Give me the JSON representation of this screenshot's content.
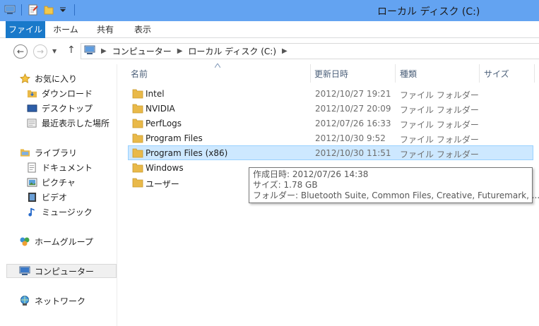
{
  "window": {
    "title": "ローカル ディスク (C:)"
  },
  "quick_access": {
    "icons": [
      "computer-icon",
      "properties-icon",
      "new-folder-icon",
      "customize-dropdown-icon"
    ]
  },
  "ribbon": {
    "tabs": [
      "ファイル",
      "ホーム",
      "共有",
      "表示"
    ],
    "active_tab": "ファイル",
    "accent": "#1979ca"
  },
  "titlebar": {
    "color": "#63a3f1"
  },
  "address": {
    "breadcrumbs": [
      "コンピューター",
      "ローカル ディスク (C:)"
    ],
    "back_symbol": "←",
    "forward_symbol": "→",
    "up_symbol": "↑",
    "recent_symbol": "▼",
    "separator": "▶"
  },
  "nav": {
    "favorites": {
      "label": "お気に入り",
      "items": [
        "ダウンロード",
        "デスクトップ",
        "最近表示した場所"
      ]
    },
    "libraries": {
      "label": "ライブラリ",
      "items": [
        "ドキュメント",
        "ピクチャ",
        "ビデオ",
        "ミュージック"
      ]
    },
    "homegroup": "ホームグループ",
    "computer": "コンピューター",
    "network": "ネットワーク"
  },
  "columns": {
    "name": "名前",
    "modified": "更新日時",
    "type": "種類",
    "size": "サイズ"
  },
  "files": [
    {
      "name": "Intel",
      "modified": "2012/10/27 19:21",
      "type": "ファイル フォルダー"
    },
    {
      "name": "NVIDIA",
      "modified": "2012/10/27 20:09",
      "type": "ファイル フォルダー"
    },
    {
      "name": "PerfLogs",
      "modified": "2012/07/26 16:33",
      "type": "ファイル フォルダー"
    },
    {
      "name": "Program Files",
      "modified": "2012/10/30 9:52",
      "type": "ファイル フォルダー"
    },
    {
      "name": "Program Files (x86)",
      "modified": "2012/10/30 11:51",
      "type": "ファイル フォルダー"
    },
    {
      "name": "Windows",
      "modified": "",
      "type": ""
    },
    {
      "name": "ユーザー",
      "modified": "",
      "type": ""
    }
  ],
  "selected_file": "Program Files (x86)",
  "tooltip": {
    "created": "作成日時: 2012/07/26 14:38",
    "size": "サイズ: 1.78 GB",
    "folders": "フォルダー: Bluetooth Suite, Common Files, Creative, Futuremark, ..."
  },
  "colors": {
    "selection": "#cde8ff",
    "folder": "#e9b949"
  }
}
